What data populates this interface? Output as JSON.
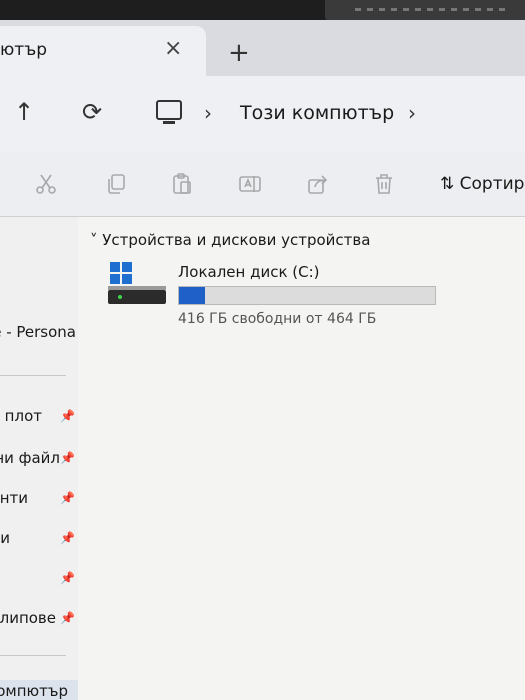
{
  "tab": {
    "title": "ютър",
    "close": "×",
    "new": "+"
  },
  "nav": {
    "up": "↑",
    "refresh": "⟳",
    "sep1": "›",
    "sep2": "›",
    "location": "Този компютър"
  },
  "toolbar": {
    "sort_label": "Сортир",
    "sort_icon": "⇅",
    "icons": [
      "scissors-icon",
      "copy-icon",
      "paste-icon",
      "rename-icon",
      "share-icon",
      "delete-icon"
    ]
  },
  "sidebar": {
    "items": [
      {
        "label": "е - Persona",
        "pinned": false
      },
      {
        "label": "н плот",
        "pinned": true
      },
      {
        "label": "ни файл",
        "pinned": true
      },
      {
        "label": "нти",
        "pinned": true
      },
      {
        "label": "и",
        "pinned": true
      },
      {
        "label": "",
        "pinned": true
      },
      {
        "label": "клипове",
        "pinned": true
      },
      {
        "label": "омпютър",
        "pinned": false
      }
    ],
    "pin_glyph": "📌"
  },
  "main": {
    "group_label": "Устройства и дискови устройства",
    "group_chevron": "˅",
    "drive": {
      "name": "Локален диск (C:)",
      "free_text": "416 ГБ свободни от 464 ГБ",
      "used_fraction": 0.1034,
      "bar_color": "#1f5fc8"
    }
  }
}
